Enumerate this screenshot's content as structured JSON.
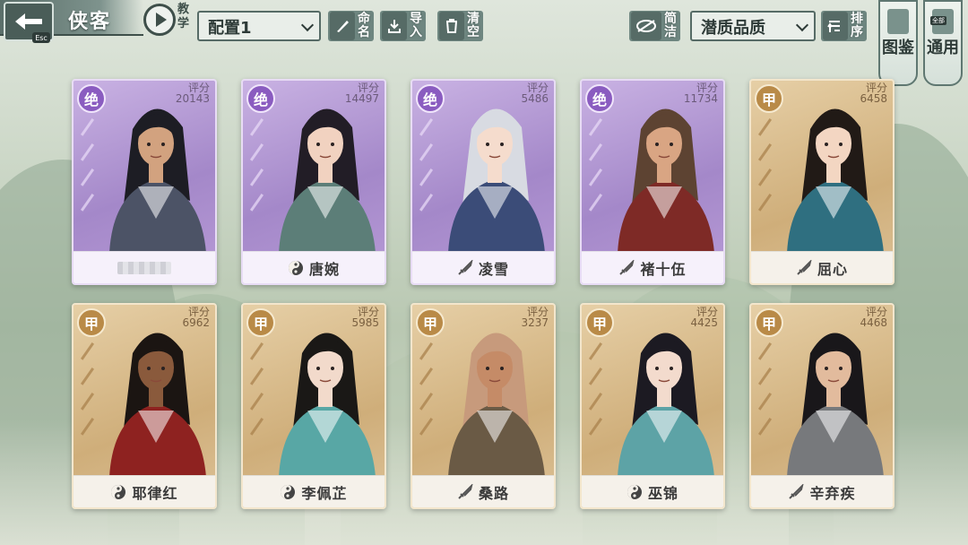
{
  "header": {
    "title": "侠客",
    "esc_label": "Esc",
    "tutorial_label": "教学",
    "config_select": "配置1",
    "rename_label": "命名",
    "import_label": "导入",
    "clear_label": "清空",
    "simple_label": "简洁",
    "quality_select": "潜质品质",
    "sort_label": "排序",
    "codex_label": "图鉴",
    "common_label": "通用",
    "common_badge": "全部"
  },
  "score_caption": "评分",
  "cards": [
    {
      "grade": "绝",
      "tier": "purple",
      "score": "20143",
      "name": "",
      "class_icon": "none",
      "hidden_name": true,
      "hair": "#1d1d24",
      "robe": "#4c5366",
      "skin": "#d2a27f"
    },
    {
      "grade": "绝",
      "tier": "purple",
      "score": "14497",
      "name": "唐婉",
      "class_icon": "swirl-icon",
      "hair": "#221d26",
      "robe": "#5c7e78",
      "skin": "#f1d2c0"
    },
    {
      "grade": "绝",
      "tier": "purple",
      "score": "5486",
      "name": "凌雪",
      "class_icon": "sword-icon",
      "hair": "#d8dbe2",
      "robe": "#3b4c78",
      "skin": "#f5dccd"
    },
    {
      "grade": "绝",
      "tier": "purple",
      "score": "11734",
      "name": "褚十伍",
      "class_icon": "sword-icon",
      "hair": "#5d4332",
      "robe": "#7e2a26",
      "skin": "#d9a583"
    },
    {
      "grade": "甲",
      "tier": "gold",
      "score": "6458",
      "name": "屈心",
      "class_icon": "sword-icon",
      "hair": "#211a16",
      "robe": "#2f6f80",
      "skin": "#f3d6c2"
    },
    {
      "grade": "甲",
      "tier": "gold",
      "score": "6962",
      "name": "耶律红",
      "class_icon": "swirl-icon",
      "hair": "#1b1512",
      "robe": "#8e2220",
      "skin": "#8a5a3c"
    },
    {
      "grade": "甲",
      "tier": "gold",
      "score": "5985",
      "name": "李佩芷",
      "class_icon": "swirl-icon",
      "hair": "#1a1816",
      "robe": "#58a7a5",
      "skin": "#f2dacb"
    },
    {
      "grade": "甲",
      "tier": "gold",
      "score": "3237",
      "name": "桑路",
      "class_icon": "sword-icon",
      "hair": "#c79a7c",
      "robe": "#6a5a45",
      "skin": "#c58b67"
    },
    {
      "grade": "甲",
      "tier": "gold",
      "score": "4425",
      "name": "巫锦",
      "class_icon": "swirl-icon",
      "hair": "#1c1a22",
      "robe": "#5da3a6",
      "skin": "#f3dbcd"
    },
    {
      "grade": "甲",
      "tier": "gold",
      "score": "4468",
      "name": "辛弃疾",
      "class_icon": "sword-icon",
      "hair": "#19171a",
      "robe": "#77797c",
      "skin": "#e2bb9d"
    }
  ]
}
